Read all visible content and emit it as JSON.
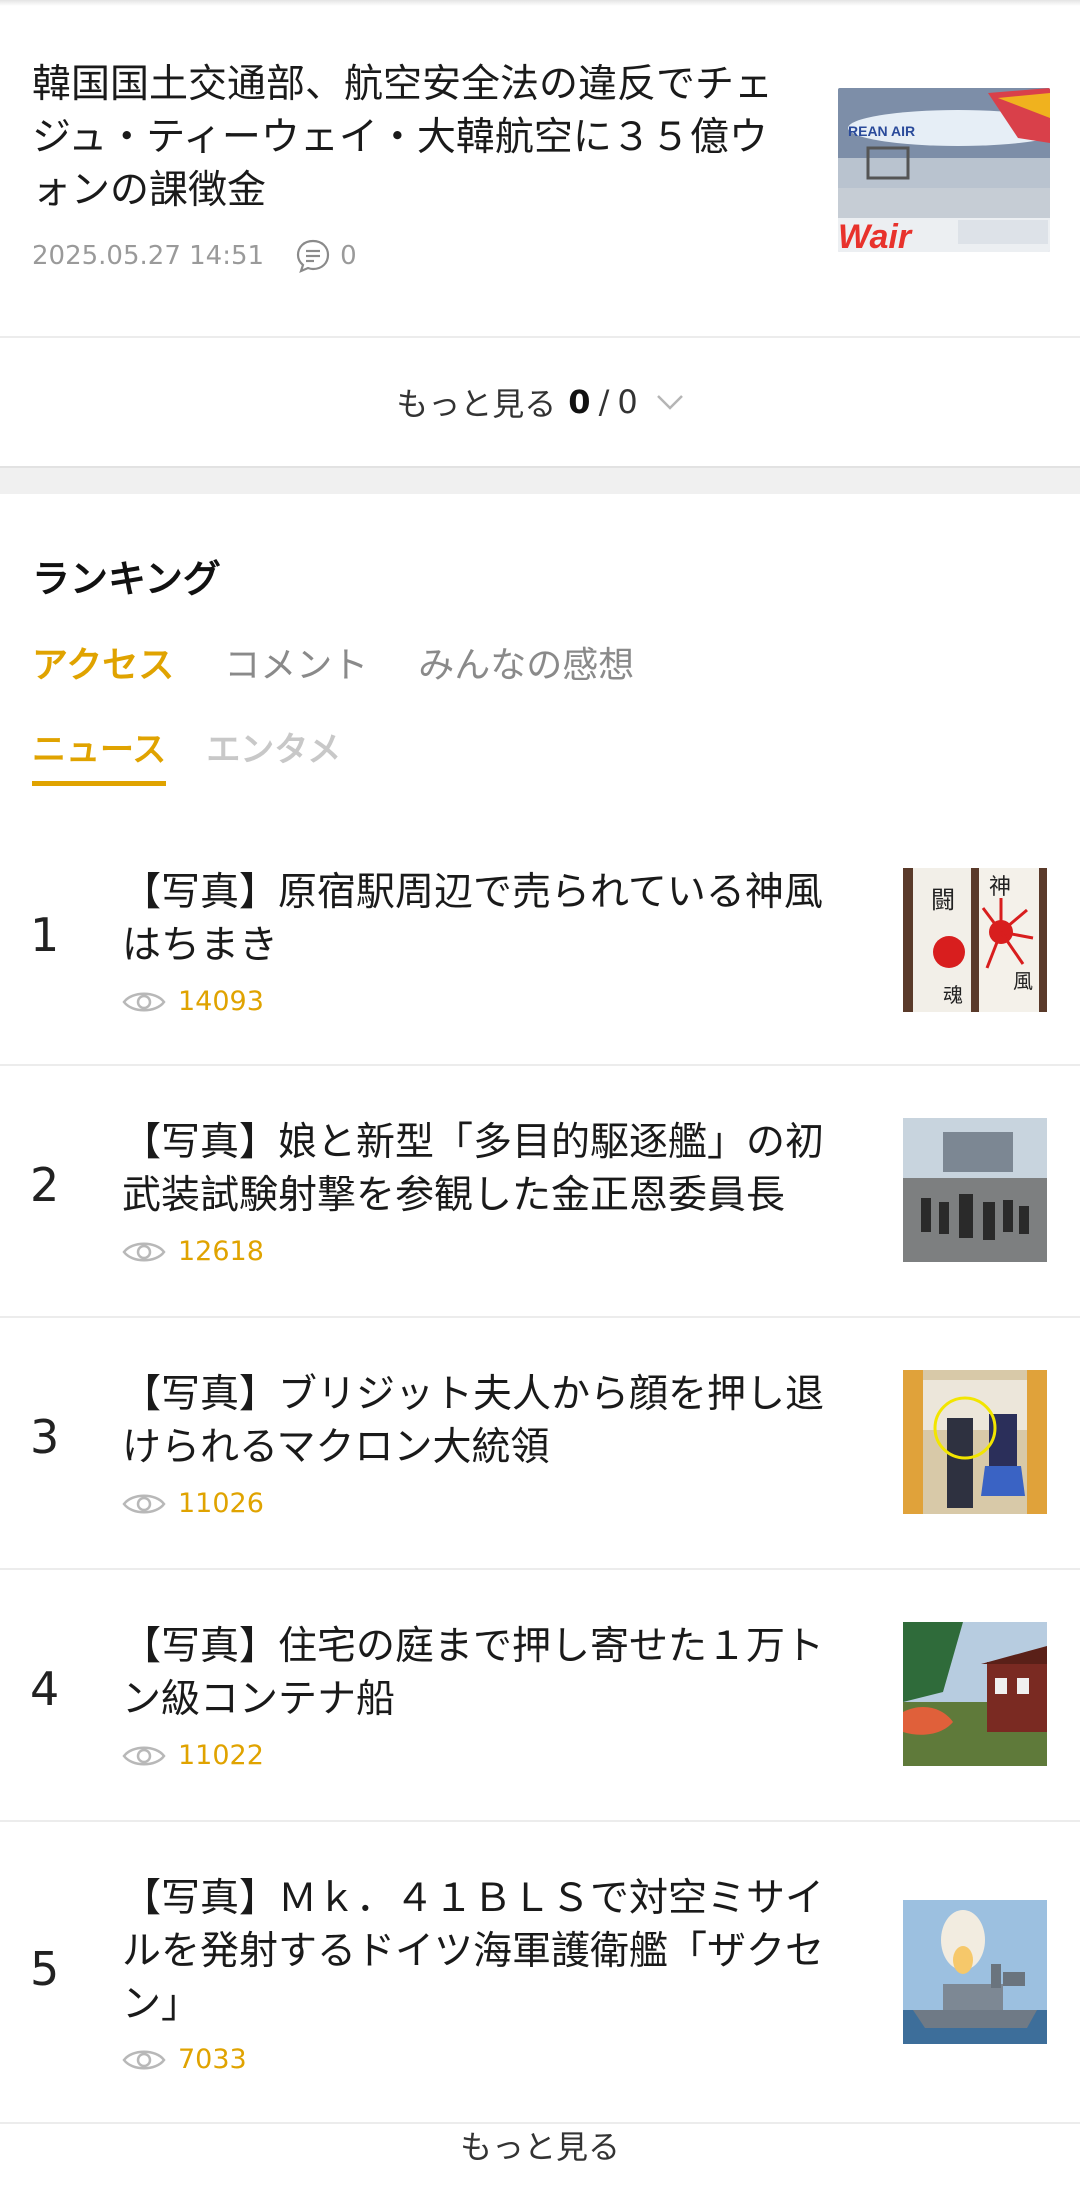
{
  "top_article": {
    "title": "韓国国土交通部、航空安全法の違反でチェジュ・ティーウェイ・大韓航空に３５億ウォンの課徴金",
    "timestamp": "2025.05.27 14:51",
    "comment_count": "0",
    "thumb_icon": "airplane-photo"
  },
  "more": {
    "label": "もっと見る",
    "current": "0",
    "sep": "/",
    "total": "0"
  },
  "ranking": {
    "title": "ランキング",
    "tabs": [
      "アクセス",
      "コメント",
      "みんなの感想"
    ],
    "subtabs": [
      "ニュース",
      "エンタメ"
    ],
    "items": [
      {
        "rank": "1",
        "title": "【写真】原宿駅周辺で売られている神風はちまき",
        "views": "14093"
      },
      {
        "rank": "2",
        "title": "【写真】娘と新型「多目的駆逐艦」の初武装試験射撃を参観した金正恩委員長",
        "views": "12618"
      },
      {
        "rank": "3",
        "title": "【写真】ブリジット夫人から顔を押し退けられるマクロン大統領",
        "views": "11026"
      },
      {
        "rank": "4",
        "title": "【写真】住宅の庭まで押し寄せた１万トン級コンテナ船",
        "views": "11022"
      },
      {
        "rank": "5",
        "title": "【写真】Ｍｋ．４１ＢＬＳで対空ミサイルを発射するドイツ海軍護衛艦「ザクセン」",
        "views": "7033"
      }
    ],
    "more_label": "もっと見る"
  },
  "colors": {
    "accent": "#e0a300"
  }
}
